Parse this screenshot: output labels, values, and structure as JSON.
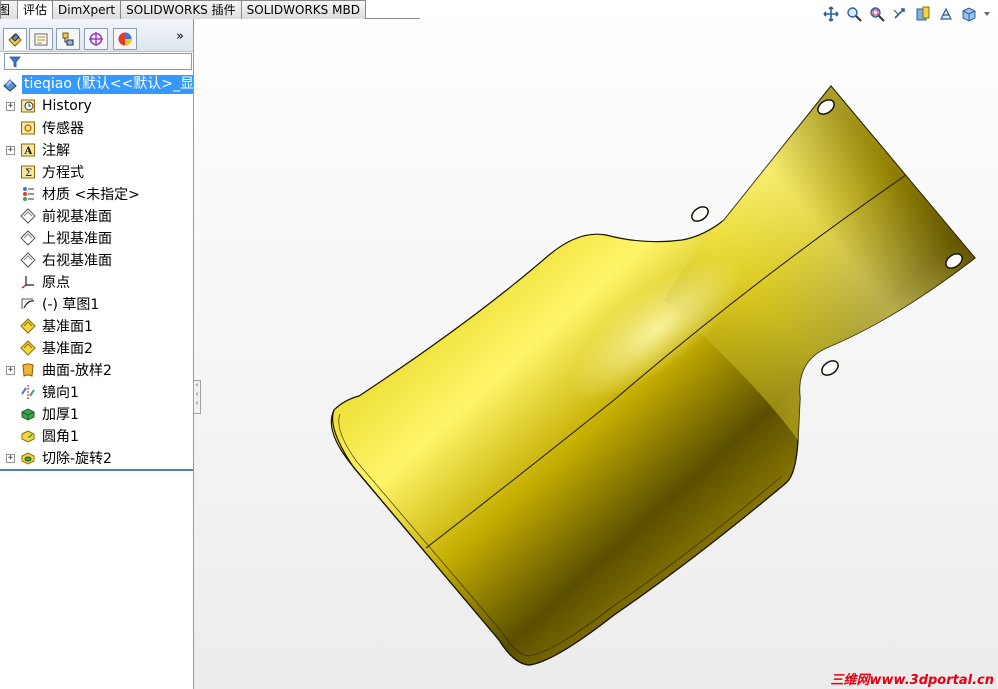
{
  "command_tabs": [
    {
      "label": "图",
      "active": false
    },
    {
      "label": "评估",
      "active": true
    },
    {
      "label": "DimXpert",
      "active": false
    },
    {
      "label": "SOLIDWORKS 插件",
      "active": false
    },
    {
      "label": "SOLIDWORKS MBD",
      "active": false
    }
  ],
  "panel": {
    "tabs": [
      "feature-manager-icon",
      "property-manager-icon",
      "configuration-manager-icon",
      "dimxpert-manager-icon",
      "display-manager-icon"
    ],
    "more_label": "»",
    "filter_icon": "filter-icon"
  },
  "tree": {
    "root": "tieqiao (默认<<默认>_显",
    "items": [
      {
        "label": "History",
        "icon": "history-icon",
        "expandable": true
      },
      {
        "label": "传感器",
        "icon": "sensor-icon",
        "expandable": false
      },
      {
        "label": "注解",
        "icon": "annotation-icon",
        "expandable": true
      },
      {
        "label": "方程式",
        "icon": "equation-icon",
        "expandable": false
      },
      {
        "label": "材质 <未指定>",
        "icon": "material-icon",
        "expandable": false
      },
      {
        "label": "前视基准面",
        "icon": "plane-icon",
        "expandable": false
      },
      {
        "label": "上视基准面",
        "icon": "plane-icon",
        "expandable": false
      },
      {
        "label": "右视基准面",
        "icon": "plane-icon",
        "expandable": false
      },
      {
        "label": "原点",
        "icon": "origin-icon",
        "expandable": false
      },
      {
        "label": "(-) 草图1",
        "icon": "sketch-icon",
        "expandable": false
      },
      {
        "label": "基准面1",
        "icon": "ref-plane-icon",
        "expandable": false
      },
      {
        "label": "基准面2",
        "icon": "ref-plane-icon",
        "expandable": false
      },
      {
        "label": "曲面-放样2",
        "icon": "surface-loft-icon",
        "expandable": true
      },
      {
        "label": "镜向1",
        "icon": "mirror-icon",
        "expandable": false
      },
      {
        "label": "加厚1",
        "icon": "thicken-icon",
        "expandable": false
      },
      {
        "label": "圆角1",
        "icon": "fillet-icon",
        "expandable": false
      },
      {
        "label": "切除-旋转2",
        "icon": "cut-revolve-icon",
        "expandable": true
      }
    ]
  },
  "hud": [
    "pan-icon",
    "zoom-to-fit-icon",
    "zoom-area-icon",
    "previous-view-icon",
    "section-view-icon",
    "view-orientation-icon",
    "display-style-icon",
    "dropdown-icon"
  ],
  "colors": {
    "part_dark": "#3a3300",
    "part_mid": "#a08a00",
    "part_light": "#f2e640",
    "selection": "#3399ff",
    "watermark": "#e60012"
  },
  "watermark": "三维网www.3dportal.cn"
}
